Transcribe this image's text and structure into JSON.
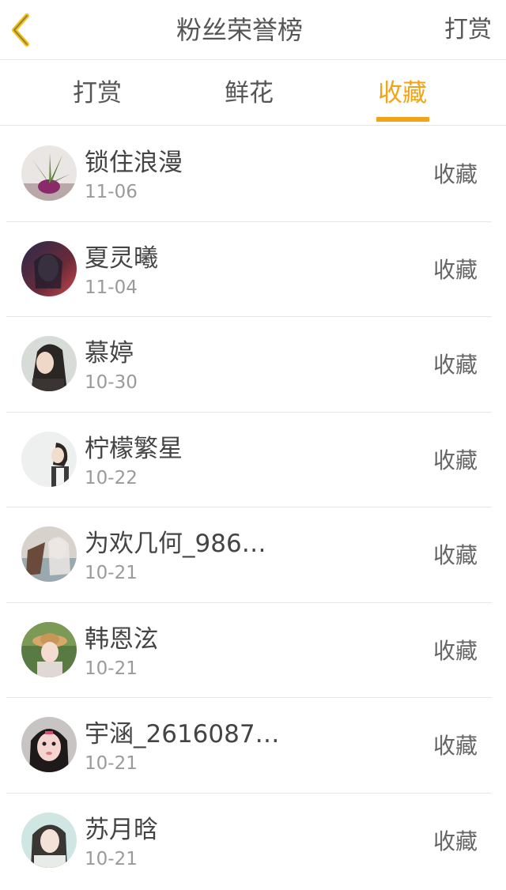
{
  "header": {
    "title": "粉丝荣誉榜",
    "right_action": "打赏",
    "back_icon": "chevron-left-icon",
    "accent_color": "#f2a316"
  },
  "tabs": [
    {
      "label": "打赏",
      "active": false
    },
    {
      "label": "鲜花",
      "active": false
    },
    {
      "label": "收藏",
      "active": true
    }
  ],
  "fans": [
    {
      "name": "锁住浪漫",
      "date": "11-06",
      "action": "收藏"
    },
    {
      "name": "夏灵曦",
      "date": "11-04",
      "action": "收藏"
    },
    {
      "name": "慕婷",
      "date": "10-30",
      "action": "收藏"
    },
    {
      "name": "柠檬繁星",
      "date": "10-22",
      "action": "收藏"
    },
    {
      "name": "为欢几何_986…",
      "date": "10-21",
      "action": "收藏"
    },
    {
      "name": "韩恩泫",
      "date": "10-21",
      "action": "收藏"
    },
    {
      "name": "宇涵_2616087…",
      "date": "10-21",
      "action": "收藏"
    },
    {
      "name": "苏月晗",
      "date": "10-21",
      "action": "收藏"
    }
  ]
}
